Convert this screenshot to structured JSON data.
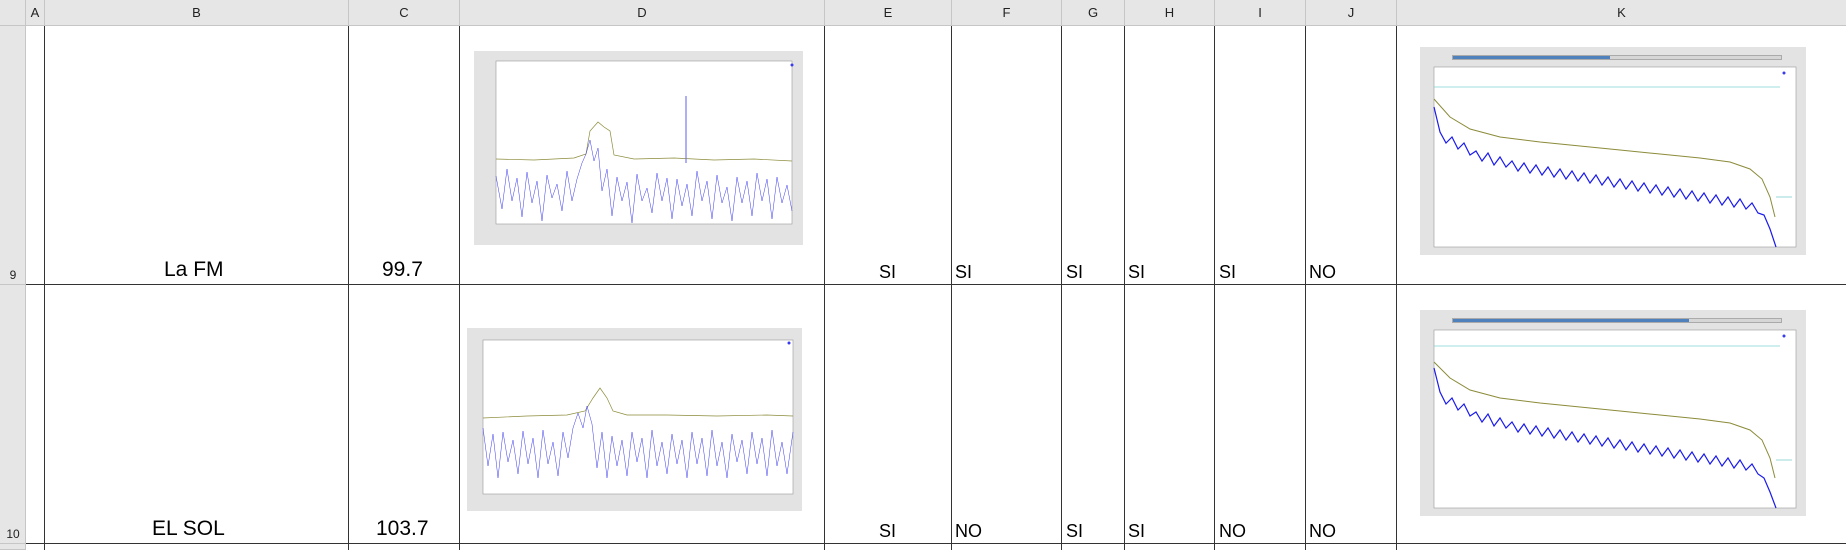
{
  "columns": [
    "A",
    "B",
    "C",
    "D",
    "E",
    "F",
    "G",
    "H",
    "I",
    "J",
    "K"
  ],
  "rows": [
    {
      "row_number": "9",
      "station": "La FM",
      "frequency": "99.7",
      "flags": [
        "SI",
        "SI",
        "SI",
        "SI",
        "SI",
        "NO"
      ]
    },
    {
      "row_number": "10",
      "station": "EL SOL",
      "frequency": "103.7",
      "flags": [
        "SI",
        "NO",
        "SI",
        "SI",
        "NO",
        "NO"
      ]
    }
  ],
  "colors": {
    "header_bg": "#e6e6e6",
    "grid": "#333333",
    "trace_blue": "#0000ee",
    "trace_olive": "#9a9a3a",
    "ref_line": "#7fd0d0",
    "progress": "#4f81bd"
  }
}
